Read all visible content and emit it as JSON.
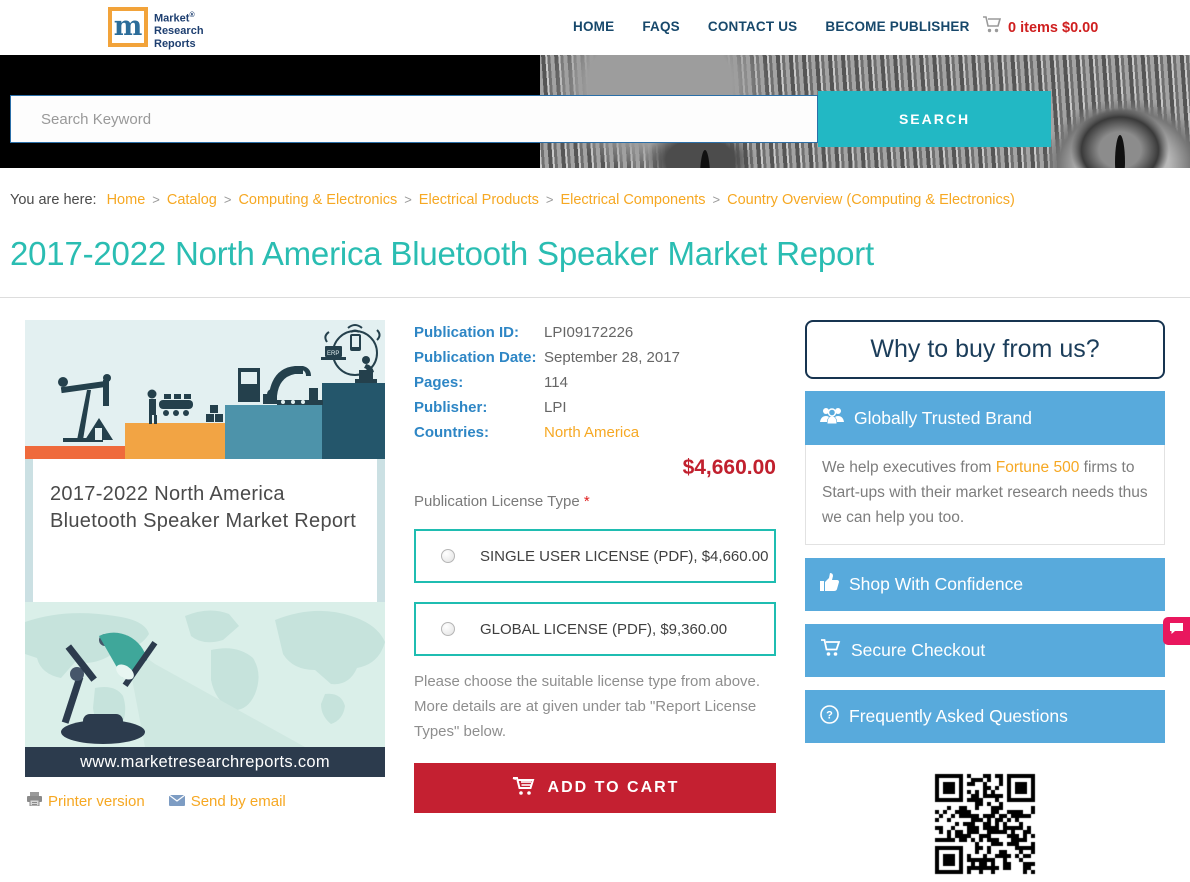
{
  "header": {
    "logo": {
      "letter": "m",
      "line1": "Market",
      "registered": "®",
      "line2": "Research",
      "line3": "Reports"
    },
    "nav": [
      "HOME",
      "FAQS",
      "CONTACT US",
      "BECOME PUBLISHER"
    ],
    "cart_status": "0 items $0.00"
  },
  "search": {
    "placeholder": "Search Keyword",
    "button_label": "SEARCH"
  },
  "breadcrumb": {
    "prefix": "You are here:",
    "separator": ">",
    "items": [
      "Home",
      "Catalog",
      "Computing & Electronics",
      "Electrical Products",
      "Electrical Components",
      "Country Overview (Computing & Electronics)"
    ]
  },
  "page_title": "2017-2022 North America Bluetooth Speaker Market Report",
  "cover": {
    "title": "2017-2022 North America Bluetooth Speaker Market Report",
    "website": "www.marketresearchreports.com"
  },
  "actions": {
    "printer": "Printer version",
    "email": "Send by email"
  },
  "details": {
    "rows": [
      {
        "label": "Publication ID:",
        "value": "LPI09172226"
      },
      {
        "label": "Publication Date:",
        "value": "September 28, 2017"
      },
      {
        "label": "Pages:",
        "value": "114"
      },
      {
        "label": "Publisher:",
        "value": "LPI"
      },
      {
        "label": "Countries:",
        "value": "North America"
      }
    ]
  },
  "price": "$4,660.00",
  "license": {
    "label": "Publication License Type ",
    "required_mark": "*",
    "options": [
      "SINGLE USER LICENSE (PDF), $4,660.00",
      "GLOBAL LICENSE (PDF), $9,360.00"
    ],
    "note": "Please choose the suitable license type from above. More details are at given under tab \"Report License Types\" below."
  },
  "add_to_cart_label": "ADD TO CART",
  "sidebar": {
    "why_title": "Why to buy from us?",
    "trusted_title": "Globally Trusted Brand",
    "trusted_body_pre": "We help executives from ",
    "trusted_link": "Fortune 500",
    "trusted_body_post": " firms to Start-ups with their market research needs thus we can help you too.",
    "banner_confidence": "Shop With Confidence",
    "banner_checkout": "Secure Checkout",
    "banner_faq": "Frequently Asked Questions"
  },
  "colors": {
    "accent_teal": "#22b8c4",
    "title_teal": "#2abdb2",
    "license_border_teal": "#1fbdb1",
    "sidebar_blue": "#58aadc",
    "label_blue": "#2e86c5",
    "nav_navy": "#17486b",
    "price_red": "#c1202e",
    "button_red": "#c42031",
    "link_orange": "#f6a823",
    "chat_pink": "#e9175e",
    "cover_navy": "#2c3b4d"
  }
}
